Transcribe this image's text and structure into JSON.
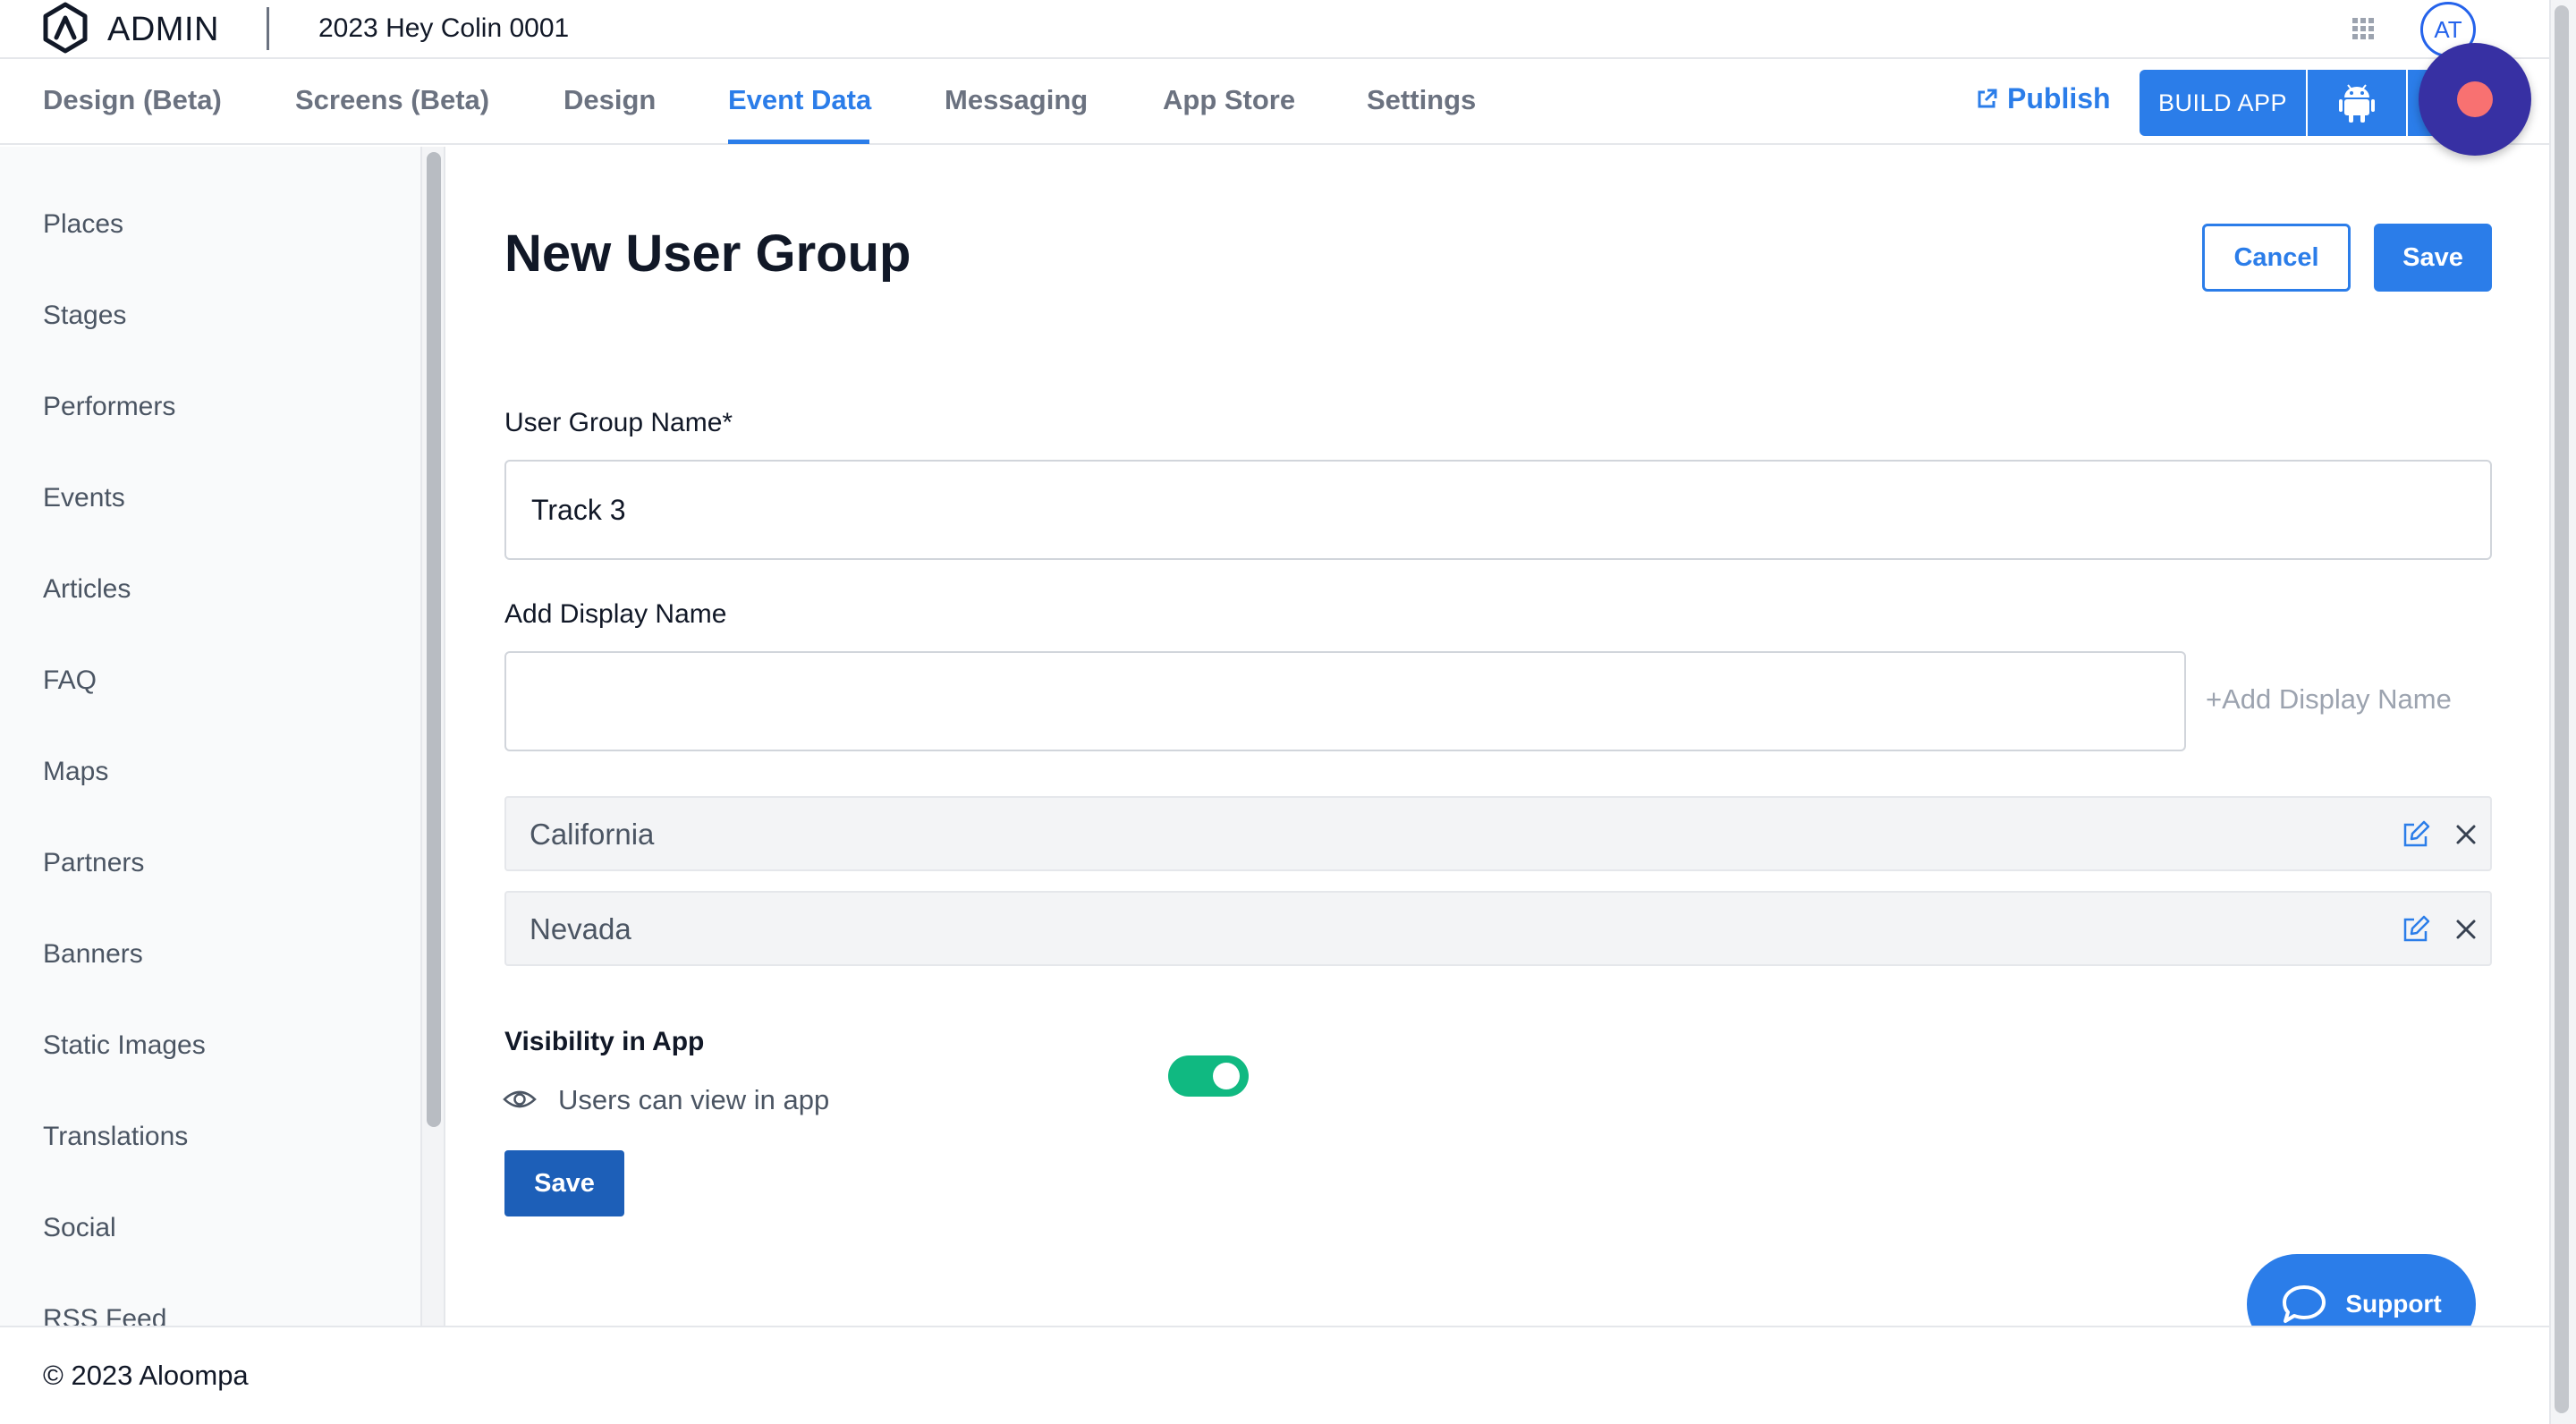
{
  "header": {
    "logo_icon": "aloompa-logo-icon",
    "admin_label": "ADMIN",
    "app_title": "2023 Hey Colin 0001",
    "apps_icon": "grid-icon",
    "avatar_initials": "AT"
  },
  "nav": {
    "tabs": [
      {
        "label": "Design (Beta)"
      },
      {
        "label": "Screens (Beta)"
      },
      {
        "label": "Design"
      },
      {
        "label": "Event Data"
      },
      {
        "label": "Messaging"
      },
      {
        "label": "App Store"
      },
      {
        "label": "Settings"
      }
    ],
    "active_tab": "Event Data",
    "publish_label": "Publish",
    "build_app_label": "BUILD APP",
    "android_icon": "android-icon",
    "record_icon": "record-icon",
    "accent_color": "#2b7de9"
  },
  "sidebar": {
    "items": [
      {
        "label": "Places"
      },
      {
        "label": "Stages"
      },
      {
        "label": "Performers"
      },
      {
        "label": "Events"
      },
      {
        "label": "Articles"
      },
      {
        "label": "FAQ"
      },
      {
        "label": "Maps"
      },
      {
        "label": "Partners"
      },
      {
        "label": "Banners"
      },
      {
        "label": "Static Images"
      },
      {
        "label": "Translations"
      },
      {
        "label": "Social"
      },
      {
        "label": "RSS Feed"
      }
    ]
  },
  "main": {
    "title": "New User Group",
    "cancel_label": "Cancel",
    "save_label": "Save",
    "group_name_label": "User Group Name*",
    "group_name_value": "Track 3",
    "display_name_label": "Add Display Name",
    "display_name_value": "",
    "add_display_name_link": "+Add Display Name",
    "display_names": [
      {
        "label": "California"
      },
      {
        "label": "Nevada"
      }
    ],
    "visibility_label": "Visibility in App",
    "visibility_sub": "Users can view in app",
    "visibility_on": true,
    "toggle_color": "#10b981",
    "save_bottom_label": "Save"
  },
  "support": {
    "label": "Support"
  },
  "footer": {
    "copyright": "© 2023 Aloompa"
  }
}
